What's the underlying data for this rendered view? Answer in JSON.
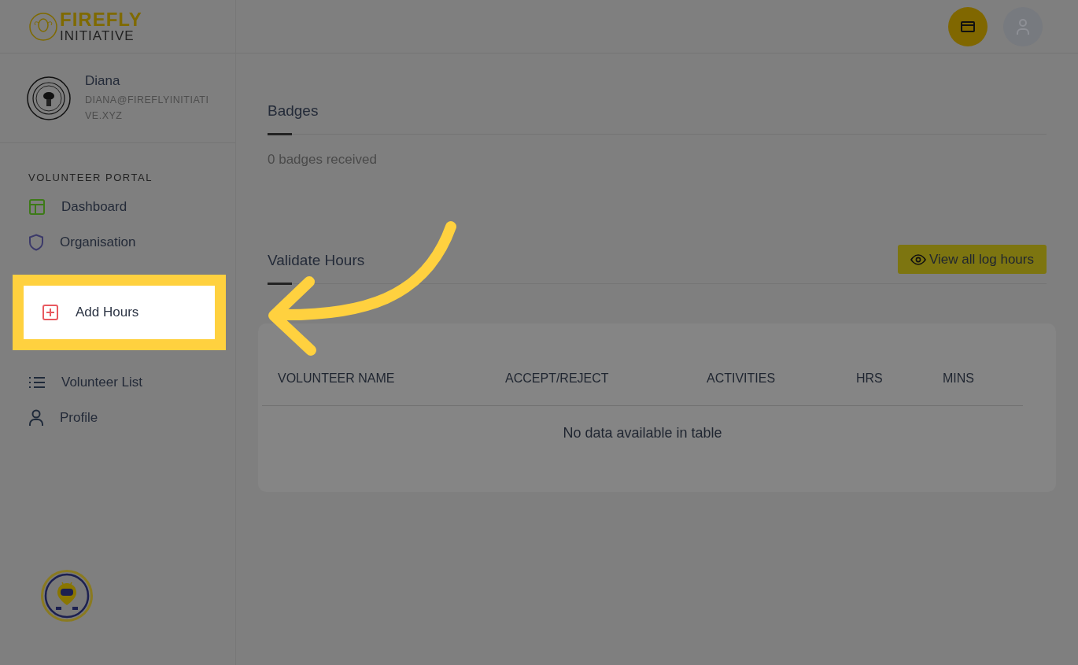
{
  "logo": {
    "line_1": "FIREFLY",
    "line_2": "INITIATIVE"
  },
  "user": {
    "name": "Diana",
    "email": "DIANA@FIREFLYINITIATIVE.XYZ"
  },
  "sidebar": {
    "section_title": "VOLUNTEER PORTAL",
    "items": [
      {
        "label": "Dashboard",
        "kind": "dashboard",
        "highlighted": false
      },
      {
        "label": "Organisation",
        "kind": "organisation",
        "highlighted": false
      },
      {
        "label": "Add Hours",
        "kind": "add",
        "highlighted": true
      },
      {
        "label": "Volunteer List",
        "kind": "list",
        "highlighted": false
      },
      {
        "label": "Profile",
        "kind": "profile",
        "highlighted": false
      }
    ]
  },
  "badges": {
    "title": "Badges",
    "text": "0 badges received"
  },
  "validate_hours": {
    "title": "Validate Hours",
    "button": "View all log hours",
    "table": {
      "columns": [
        "VOLUNTEER NAME",
        "ACCEPT/REJECT",
        "ACTIVITIES",
        "HRS",
        "MINS"
      ],
      "empty_text": "No data available in table"
    }
  }
}
